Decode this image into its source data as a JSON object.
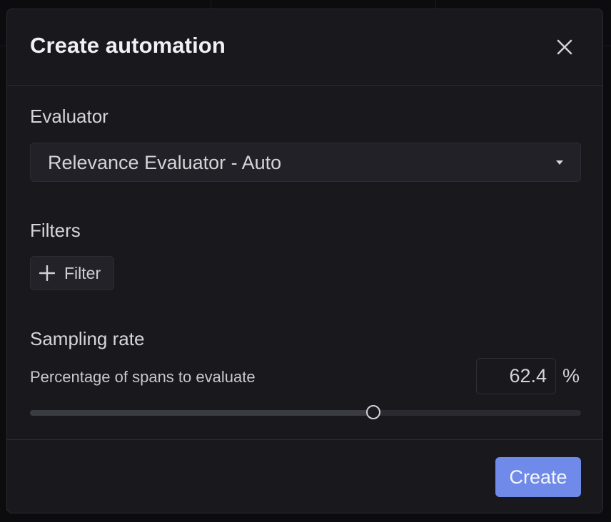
{
  "dialog": {
    "title": "Create automation",
    "close_icon": "close-icon"
  },
  "evaluator": {
    "label": "Evaluator",
    "selected": "Relevance Evaluator - Auto",
    "caret_icon": "caret-down-icon"
  },
  "filters": {
    "label": "Filters",
    "add_button_label": "Filter",
    "add_icon": "plus-icon"
  },
  "sampling": {
    "label": "Sampling rate",
    "helper": "Percentage of spans to evaluate",
    "value": "62.4",
    "unit": "%",
    "slider_fraction": 0.624
  },
  "footer": {
    "create_label": "Create"
  },
  "colors": {
    "accent": "#6f8ae9",
    "surface": "#18181d"
  }
}
